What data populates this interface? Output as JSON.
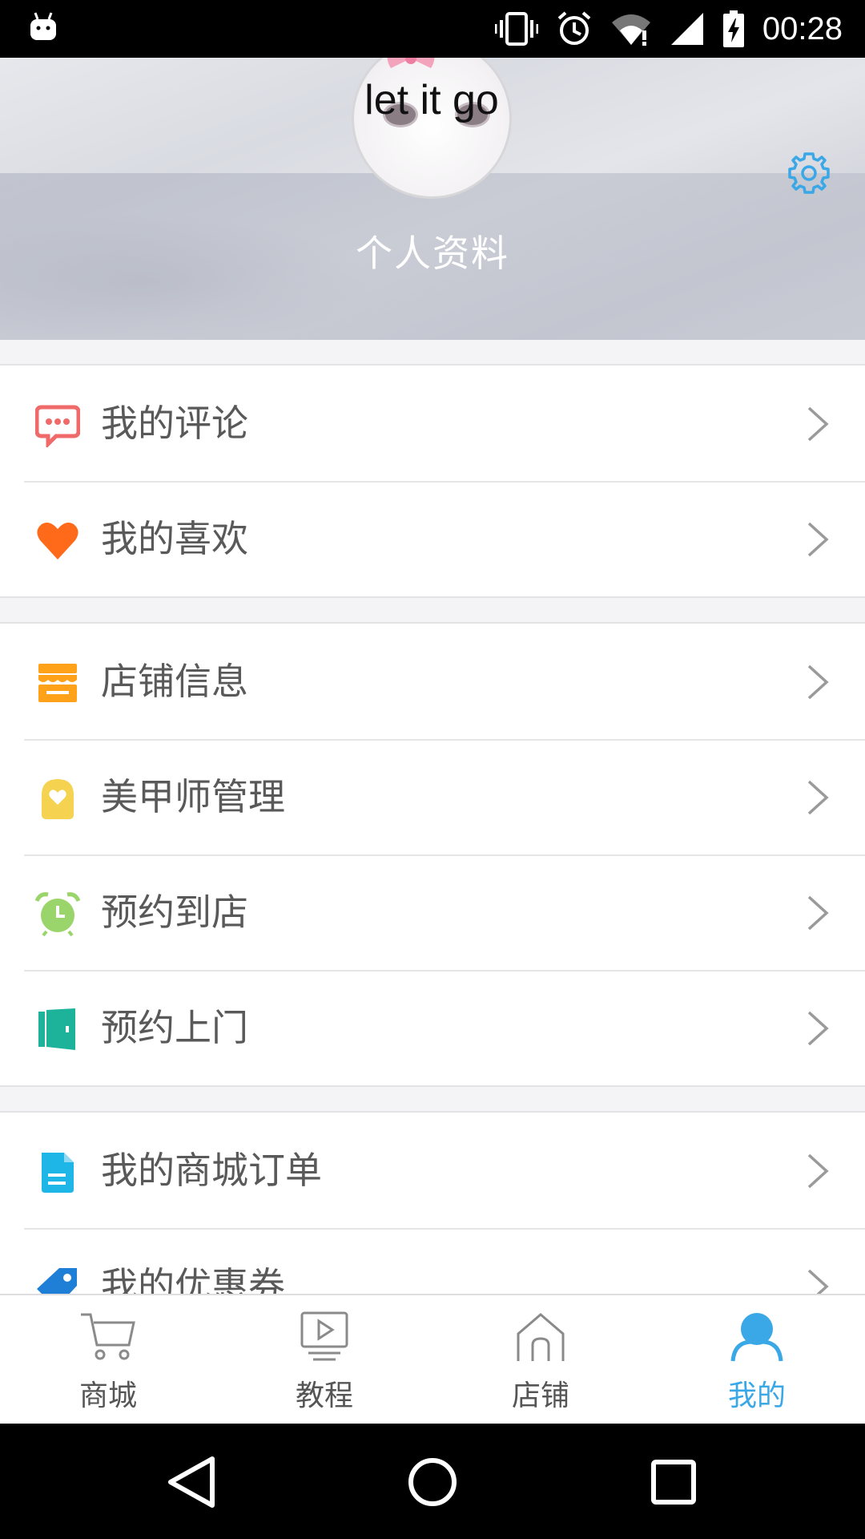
{
  "status_bar": {
    "time": "00:28",
    "icons": [
      "android-debug-icon",
      "vibrate-icon",
      "alarm-icon",
      "wifi-icon",
      "cell-signal-icon",
      "battery-charging-icon"
    ]
  },
  "header": {
    "username": "let it go",
    "profile_label": "个人资料",
    "settings_icon": "gear-icon",
    "settings_color": "#3aa7e6"
  },
  "menu_groups": [
    {
      "items": [
        {
          "label": "我的评论",
          "icon": "comment-icon",
          "color": "#f06a6a"
        },
        {
          "label": "我的喜欢",
          "icon": "heart-icon",
          "color": "#ff6a1a"
        }
      ]
    },
    {
      "items": [
        {
          "label": "店铺信息",
          "icon": "store-icon",
          "color": "#ffa21a"
        },
        {
          "label": "美甲师管理",
          "icon": "manicurist-icon",
          "color": "#f5d24f"
        },
        {
          "label": "预约到店",
          "icon": "alarm-clock-icon",
          "color": "#9ad56b"
        },
        {
          "label": "预约上门",
          "icon": "door-icon",
          "color": "#1db39a"
        }
      ]
    },
    {
      "items": [
        {
          "label": "我的商城订单",
          "icon": "order-document-icon",
          "color": "#1eb6e6"
        },
        {
          "label": "我的优惠券",
          "icon": "coupon-tag-icon",
          "color": "#1f7fd6"
        }
      ]
    }
  ],
  "bottom_nav": {
    "items": [
      {
        "label": "商城",
        "icon": "cart-icon"
      },
      {
        "label": "教程",
        "icon": "video-play-icon"
      },
      {
        "label": "店铺",
        "icon": "home-icon"
      },
      {
        "label": "我的",
        "icon": "person-icon"
      }
    ],
    "active_index": 3,
    "active_color": "#3aa7e6",
    "inactive_color": "#8a8a8a"
  },
  "system_nav": [
    "back-icon",
    "home-circle-icon",
    "recents-icon"
  ]
}
